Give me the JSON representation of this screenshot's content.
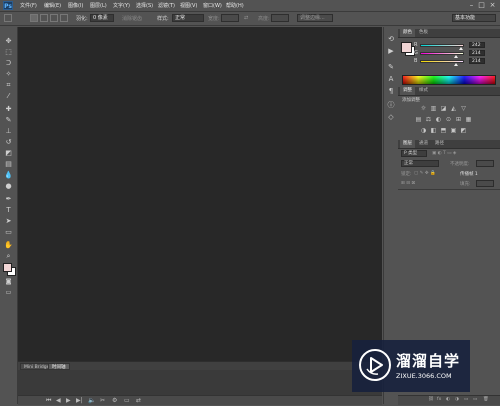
{
  "app": {
    "logo": "Ps"
  },
  "menubar": {
    "items": [
      "文件(F)",
      "编辑(E)",
      "图像(I)",
      "图层(L)",
      "文字(Y)",
      "选择(S)",
      "滤镜(T)",
      "视图(V)",
      "窗口(W)",
      "帮助(H)"
    ],
    "window_controls": [
      "–",
      "□",
      "×"
    ]
  },
  "options_bar": {
    "feather_label": "羽化:",
    "feather_value": "0 像素",
    "antialias_label": "消除锯齿",
    "style_label": "样式:",
    "style_value": "正常",
    "width_label": "宽度:",
    "height_label": "高度:",
    "refine_edge_label": "调整边缘...",
    "workspace_value": "基本功能"
  },
  "toolbar": {
    "icons": [
      "move-icon",
      "marquee-icon",
      "lasso-icon",
      "quick-select-icon",
      "crop-icon",
      "eyedropper-icon",
      "healing-brush-icon",
      "brush-icon",
      "clone-stamp-icon",
      "history-brush-icon",
      "eraser-icon",
      "gradient-icon",
      "blur-icon",
      "dodge-icon",
      "pen-icon",
      "type-icon",
      "path-select-icon",
      "shape-icon",
      "hand-icon",
      "zoom-icon"
    ],
    "glyphs": [
      "✥",
      "⬚",
      "ᑐ",
      "✧",
      "⌗",
      "⁄",
      "✚",
      "✎",
      "⊥",
      "↺",
      "◩",
      "▤",
      "💧",
      "●",
      "✒",
      "T",
      "➤",
      "▭",
      "✋",
      "⌕"
    ],
    "foreground_color": "#f2d6d6",
    "background_color": "#ffffff"
  },
  "bottom_tabs": [
    "Mini Bridge",
    "时间轴"
  ],
  "timeline": {
    "controls": [
      "⏮",
      "◀",
      "▶",
      "▶|",
      "🔈",
      "✂",
      "⚙",
      "▭",
      "⇄"
    ]
  },
  "dock": {
    "icons": [
      "history-icon",
      "actions-icon",
      "brush-preset-icon",
      "character-icon",
      "paragraph-icon",
      "info-icon",
      "swatches-3d-icon"
    ],
    "glyphs": [
      "⟲",
      "▶",
      "✎",
      "A",
      "¶",
      "ⓘ",
      "◇"
    ]
  },
  "color_panel": {
    "tabs": [
      "颜色",
      "色板"
    ],
    "channels": [
      {
        "label": "R",
        "value": "242",
        "fraction": 0.949,
        "gradient": "linear-gradient(to right,#00d6d6,#ffd6d6)"
      },
      {
        "label": "G",
        "value": "214",
        "fraction": 0.839,
        "gradient": "linear-gradient(to right,#f200d6,#f2ffd6)"
      },
      {
        "label": "B",
        "value": "214",
        "fraction": 0.839,
        "gradient": "linear-gradient(to right,#f2d600,#f2d6ff)"
      }
    ],
    "swatch": "#f2d6d6"
  },
  "adjustments_panel": {
    "tabs": [
      "调整",
      "样式"
    ],
    "title": "添加调整",
    "row1": [
      "☼",
      "▥",
      "◪",
      "◭",
      "▽"
    ],
    "row2": [
      "▤",
      "⚖",
      "◐",
      "⊙",
      "⊞",
      "▦"
    ],
    "row3": [
      "◑",
      "◧",
      "⬒",
      "▣",
      "◩"
    ]
  },
  "layers_panel": {
    "tabs": [
      "图层",
      "通道",
      "路径"
    ],
    "kind_label": "P 类型",
    "blend_mode": "正常",
    "opacity_label": "不透明度:",
    "lock_label": "锁定:",
    "fill_label": "填充:",
    "pass_through_label": "传播帧 1",
    "footer_icons": [
      "⛓",
      "fx",
      "◐",
      "◑",
      "▭",
      "▭",
      "🗑"
    ]
  },
  "watermark": {
    "title": "溜溜自学",
    "url": "ZIXUE.3066.COM"
  }
}
